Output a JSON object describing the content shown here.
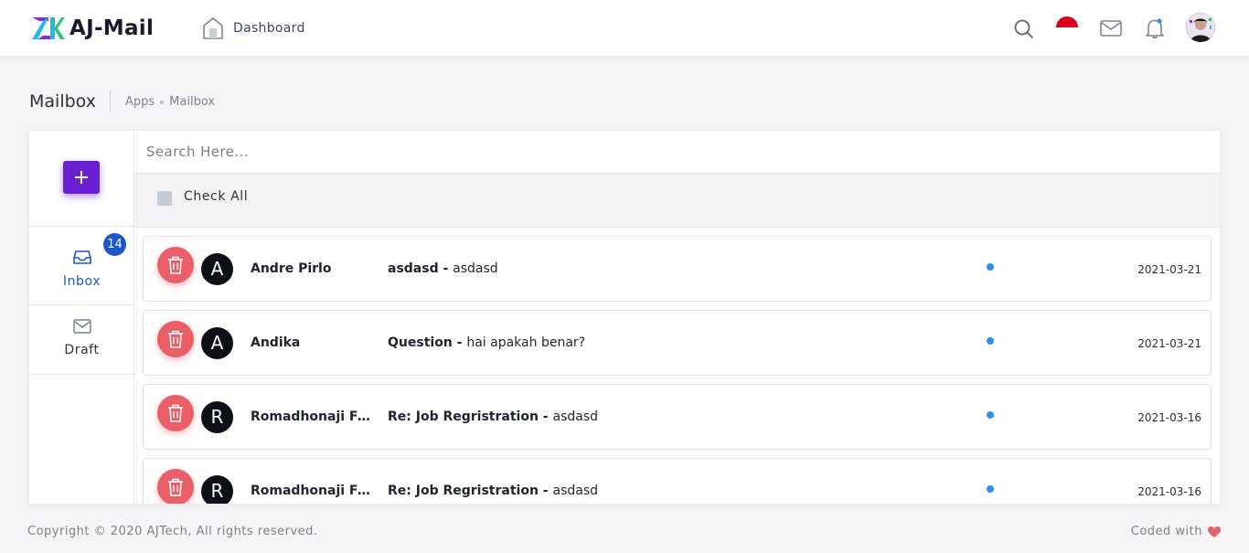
{
  "header": {
    "app_name": "AJ-Mail",
    "nav_dashboard": "Dashboard",
    "icons": [
      "search-icon",
      "indonesia-flag-icon",
      "mail-icon",
      "bell-icon",
      "user-avatar"
    ]
  },
  "breadcrumb": {
    "title": "Mailbox",
    "items": [
      "Apps",
      "Mailbox"
    ]
  },
  "sidebar": {
    "compose_icon": "plus-icon",
    "items": [
      {
        "label": "Inbox",
        "icon": "inbox-icon",
        "badge": "14",
        "active": true
      },
      {
        "label": "Draft",
        "icon": "mail-icon",
        "active": false
      }
    ]
  },
  "search": {
    "placeholder": "Search Here..."
  },
  "check_all_label": "Check All",
  "emails": [
    {
      "avatar": "A",
      "sender": "Andre Pirlo",
      "subject": "asdasd - ",
      "snippet": "asdasd",
      "date": "2021-03-21"
    },
    {
      "avatar": "A",
      "sender": "Andika",
      "subject": "Question - ",
      "snippet": "hai apakah benar?",
      "date": "2021-03-21"
    },
    {
      "avatar": "R",
      "sender": "Romadhonaji Fou…",
      "subject": "Re: Job Regristration - ",
      "snippet": "asdasd",
      "date": "2021-03-16"
    },
    {
      "avatar": "R",
      "sender": "Romadhonaji Fou…",
      "subject": "Re: Job Regristration - ",
      "snippet": "asdasd",
      "date": "2021-03-16"
    }
  ],
  "footer": {
    "copyright": "Copyright © 2020 AJTech, All rights reserved.",
    "coded_with": "Coded with"
  },
  "colors": {
    "accent": "#6a1fd0",
    "inbox_active": "#1d56c9",
    "delete": "#ea5e68",
    "unread_dot": "#2a8ff0",
    "heart": "#e8616b"
  }
}
